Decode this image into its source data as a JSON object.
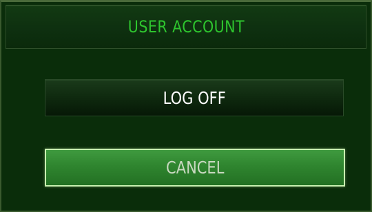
{
  "dialog": {
    "title": "USER ACCOUNT"
  },
  "buttons": {
    "log_off_label": "LOG OFF",
    "cancel_label": "CANCEL"
  },
  "colors": {
    "background": "#0a2d0a",
    "title_text": "#2ec52e",
    "log_off_text": "#ffffff",
    "cancel_fill": "#2f852f",
    "cancel_border": "#c8f0b0"
  }
}
